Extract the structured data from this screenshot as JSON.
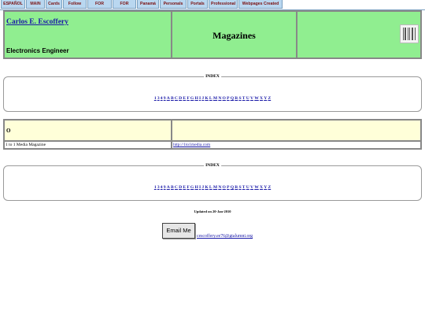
{
  "nav": [
    "ESPAÑOL",
    "MAIN",
    "Cards",
    "Follow Me",
    "FOR RENT",
    "FOR SALE",
    "Panamá",
    "Personals",
    "Portals",
    "Professional",
    "Webpages Created"
  ],
  "header": {
    "name": "Carlos E. Escoffery",
    "role": "Electronics Engineer",
    "title": "Magazines"
  },
  "index": {
    "legend": "INDEX",
    "letters": [
      "1",
      "3",
      "4",
      "9",
      "A",
      "B",
      "C",
      "D",
      "E",
      "F",
      "G",
      "H",
      "I",
      "J",
      "K",
      "L",
      "M",
      "N",
      "O",
      "P",
      "Q",
      "R",
      "S",
      "T",
      "U",
      "V",
      "W",
      "X",
      "Y",
      "Z"
    ]
  },
  "section": {
    "letter": "O",
    "rows": [
      {
        "name": "1 to 1 Media Magazine",
        "url": "http://1to1media.com"
      }
    ]
  },
  "footer": {
    "updated": "Updated on 20-Jan-2010",
    "email_button": "Email Me",
    "email": "cescoffery.ee76@gtalumni.org"
  }
}
